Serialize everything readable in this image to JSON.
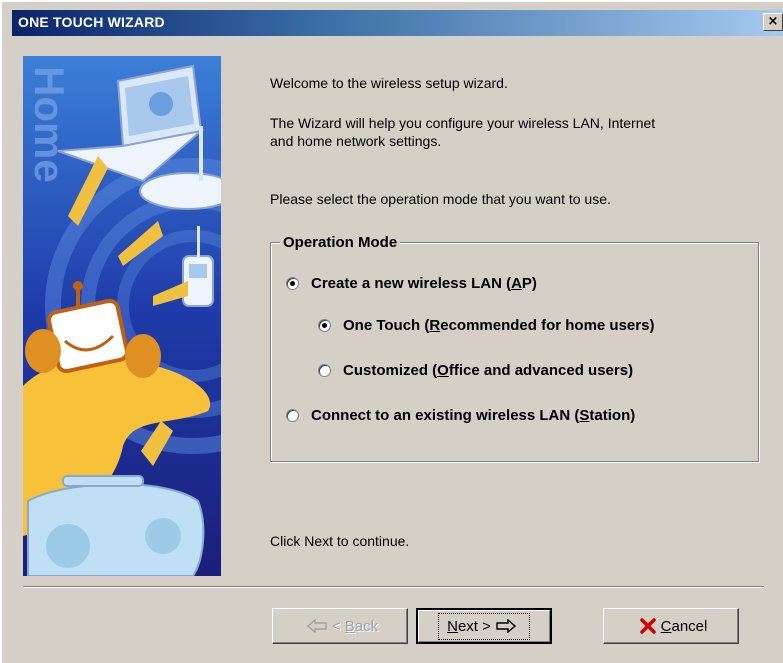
{
  "window": {
    "title": "ONE TOUCH WIZARD",
    "close_glyph": "×"
  },
  "banner": {
    "watermark": "Home"
  },
  "intro": {
    "welcome": "Welcome to the wireless setup wizard.",
    "description_line1": "The Wizard will help you configure your wireless LAN, Internet",
    "description_line2": "and home network settings.",
    "prompt": "Please select the operation mode that you want to use."
  },
  "operation_mode": {
    "label": "Operation Mode",
    "options": [
      {
        "pre": "Create a new wireless LAN (",
        "key": "A",
        "post": "P)",
        "checked": true
      },
      {
        "pre": "One Touch (",
        "key": "R",
        "post": "ecommended for home users)",
        "checked": true
      },
      {
        "pre": "Customized (",
        "key": "O",
        "post": "ffice and advanced users)",
        "checked": false
      },
      {
        "pre": "Connect to an existing wireless LAN (",
        "key": "S",
        "post": "tation)",
        "checked": false
      }
    ]
  },
  "footer": {
    "continue_text": "Click Next to continue."
  },
  "buttons": {
    "back": {
      "pre": "< ",
      "key": "B",
      "post": "ack",
      "enabled": false
    },
    "next": {
      "pre": "",
      "key": "N",
      "post": "ext >"
    },
    "cancel": {
      "pre": "",
      "key": "C",
      "post": "ancel"
    }
  },
  "icons": {
    "back": "arrow-left-icon",
    "next": "arrow-right-icon",
    "cancel": "x-icon"
  },
  "colors": {
    "dialog": "#d4d0c8",
    "titlebar": "#0a246a",
    "cancel_x": "#d00000"
  }
}
